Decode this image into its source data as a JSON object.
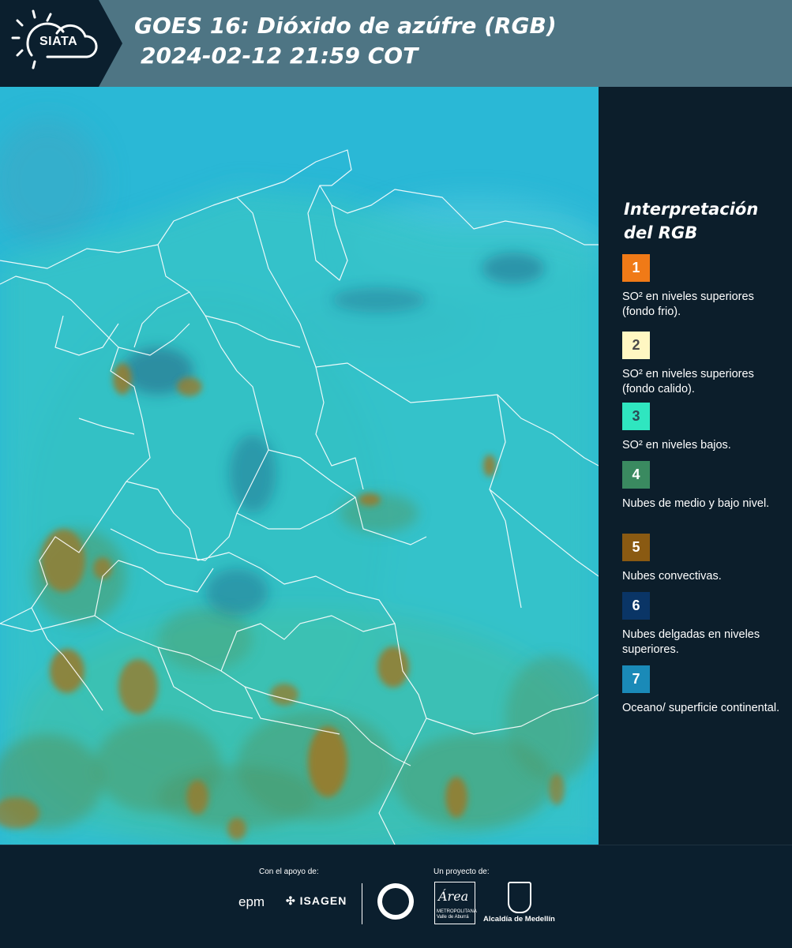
{
  "header": {
    "logo_text": "SIATA",
    "title_line1": "GOES 16: Dióxido de azúfre (RGB)",
    "title_line2": "2024-02-12 21:59 COT"
  },
  "legend": {
    "title_line1": "Interpretación",
    "title_line2": "del RGB",
    "items": [
      {
        "number": "1",
        "color": "#f07a17",
        "text_color": "#ffffff",
        "description": "SO² en niveles superiores (fondo frio)."
      },
      {
        "number": "2",
        "color": "#fff7c2",
        "text_color": "#4a4a4a",
        "description": "SO² en niveles superiores (fondo calido)."
      },
      {
        "number": "3",
        "color": "#2fe6c0",
        "text_color": "#2a4a55",
        "description": "SO² en niveles bajos."
      },
      {
        "number": "4",
        "color": "#3a8a60",
        "text_color": "#ffffff",
        "description": "Nubes de medio y bajo nivel."
      },
      {
        "number": "5",
        "color": "#8a5a12",
        "text_color": "#ffffff",
        "description": "Nubes convectivas."
      },
      {
        "number": "6",
        "color": "#0a3566",
        "text_color": "#ffffff",
        "description": "Nubes delgadas en niveles superiores."
      },
      {
        "number": "7",
        "color": "#1a8ab8",
        "text_color": "#ffffff",
        "description": "Oceano/ superficie continental."
      }
    ]
  },
  "footer": {
    "support_label": "Con el apoyo de:",
    "project_label": "Un proyecto de:",
    "sponsor1": "epm",
    "sponsor2": "ISAGEN",
    "area_name": "Área",
    "area_sub": "METROPOLITANA Valle de Aburrá",
    "alcaldia": "Alcaldía de Medellín"
  },
  "colors": {
    "header_bg": "#4e7584",
    "logo_bg": "#0b1f2e",
    "map_cyan": "#2ab8d6",
    "land_teal": "#35c6c4",
    "convective_brown": "#9a7a2a",
    "mid_cloud_green": "#4e9a6a",
    "thin_cloud_navy": "#1e4f78",
    "border_white": "#ffffff"
  }
}
